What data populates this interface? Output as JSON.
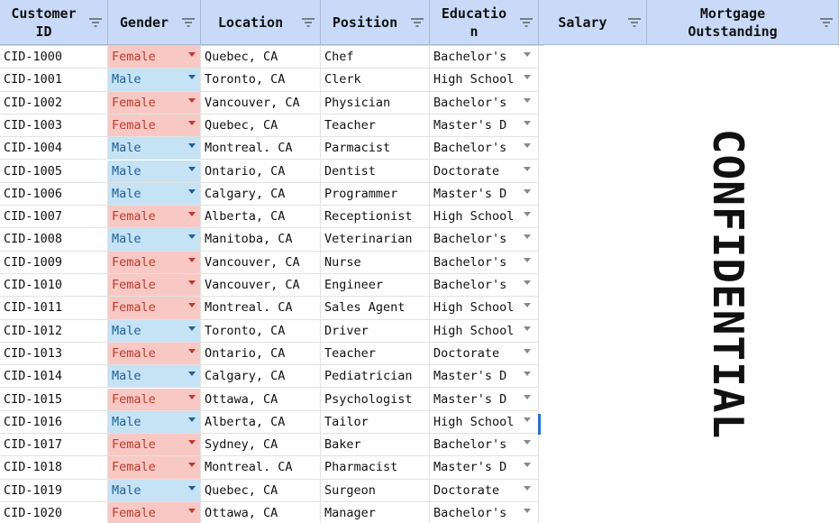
{
  "sheet": {
    "headers": [
      {
        "id": "customer_id",
        "label": "Customer\nID"
      },
      {
        "id": "gender",
        "label": "Gender"
      },
      {
        "id": "location",
        "label": "Location"
      },
      {
        "id": "position",
        "label": "Position"
      },
      {
        "id": "education",
        "label": "Educatio\nn"
      },
      {
        "id": "salary",
        "label": "Salary"
      },
      {
        "id": "mortgage",
        "label": "Mortgage\nOutstanding"
      }
    ],
    "rows": [
      {
        "id": "CID-1000",
        "gender": "Female",
        "location": "Quebec, CA",
        "position": "Chef",
        "education": "Bachelor's"
      },
      {
        "id": "CID-1001",
        "gender": "Male",
        "location": "Toronto, CA",
        "position": "Clerk",
        "education": "High School"
      },
      {
        "id": "CID-1002",
        "gender": "Female",
        "location": "Vancouver, CA",
        "position": "Physician",
        "education": "Bachelor's"
      },
      {
        "id": "CID-1003",
        "gender": "Female",
        "location": "Quebec, CA",
        "position": "Teacher",
        "education": "Master's D"
      },
      {
        "id": "CID-1004",
        "gender": "Male",
        "location": "Montreal. CA",
        "position": "Parmacist",
        "education": "Bachelor's"
      },
      {
        "id": "CID-1005",
        "gender": "Male",
        "location": "Ontario, CA",
        "position": "Dentist",
        "education": "Doctorate"
      },
      {
        "id": "CID-1006",
        "gender": "Male",
        "location": "Calgary, CA",
        "position": "Programmer",
        "education": "Master's D"
      },
      {
        "id": "CID-1007",
        "gender": "Female",
        "location": "Alberta, CA",
        "position": "Receptionist",
        "education": "High School"
      },
      {
        "id": "CID-1008",
        "gender": "Male",
        "location": "Manitoba, CA",
        "position": "Veterinarian",
        "education": "Bachelor's"
      },
      {
        "id": "CID-1009",
        "gender": "Female",
        "location": "Vancouver, CA",
        "position": "Nurse",
        "education": "Bachelor's"
      },
      {
        "id": "CID-1010",
        "gender": "Female",
        "location": "Vancouver, CA",
        "position": "Engineer",
        "education": "Bachelor's"
      },
      {
        "id": "CID-1011",
        "gender": "Female",
        "location": "Montreal. CA",
        "position": "Sales Agent",
        "education": "High School"
      },
      {
        "id": "CID-1012",
        "gender": "Male",
        "location": "Toronto, CA",
        "position": "Driver",
        "education": "High School"
      },
      {
        "id": "CID-1013",
        "gender": "Female",
        "location": "Ontario, CA",
        "position": "Teacher",
        "education": "Doctorate"
      },
      {
        "id": "CID-1014",
        "gender": "Male",
        "location": "Calgary, CA",
        "position": "Pediatrician",
        "education": "Master's D"
      },
      {
        "id": "CID-1015",
        "gender": "Female",
        "location": "Ottawa, CA",
        "position": "Psychologist",
        "education": "Master's D"
      },
      {
        "id": "CID-1016",
        "gender": "Male",
        "location": "Alberta, CA",
        "position": "Tailor",
        "education": "High School"
      },
      {
        "id": "CID-1017",
        "gender": "Female",
        "location": "Sydney, CA",
        "position": "Baker",
        "education": "Bachelor's"
      },
      {
        "id": "CID-1018",
        "gender": "Female",
        "location": "Montreal. CA",
        "position": "Pharmacist",
        "education": "Master's D"
      },
      {
        "id": "CID-1019",
        "gender": "Male",
        "location": "Quebec, CA",
        "position": "Surgeon",
        "education": "Doctorate"
      },
      {
        "id": "CID-1020",
        "gender": "Female",
        "location": "Ottawa, CA",
        "position": "Manager",
        "education": "Bachelor's"
      }
    ]
  },
  "overlay": {
    "text": "CONFIDENTIAL"
  },
  "colors": {
    "header_bg": "#c9daf8",
    "female_bg": "#f8c9c4",
    "female_text": "#c0392b",
    "male_bg": "#c6e2f5",
    "male_text": "#1f5f99",
    "selection": "#1a73e8"
  },
  "icons": {
    "header_filter": "filter-icon",
    "cell_dropdown": "dropdown-arrow-icon"
  }
}
